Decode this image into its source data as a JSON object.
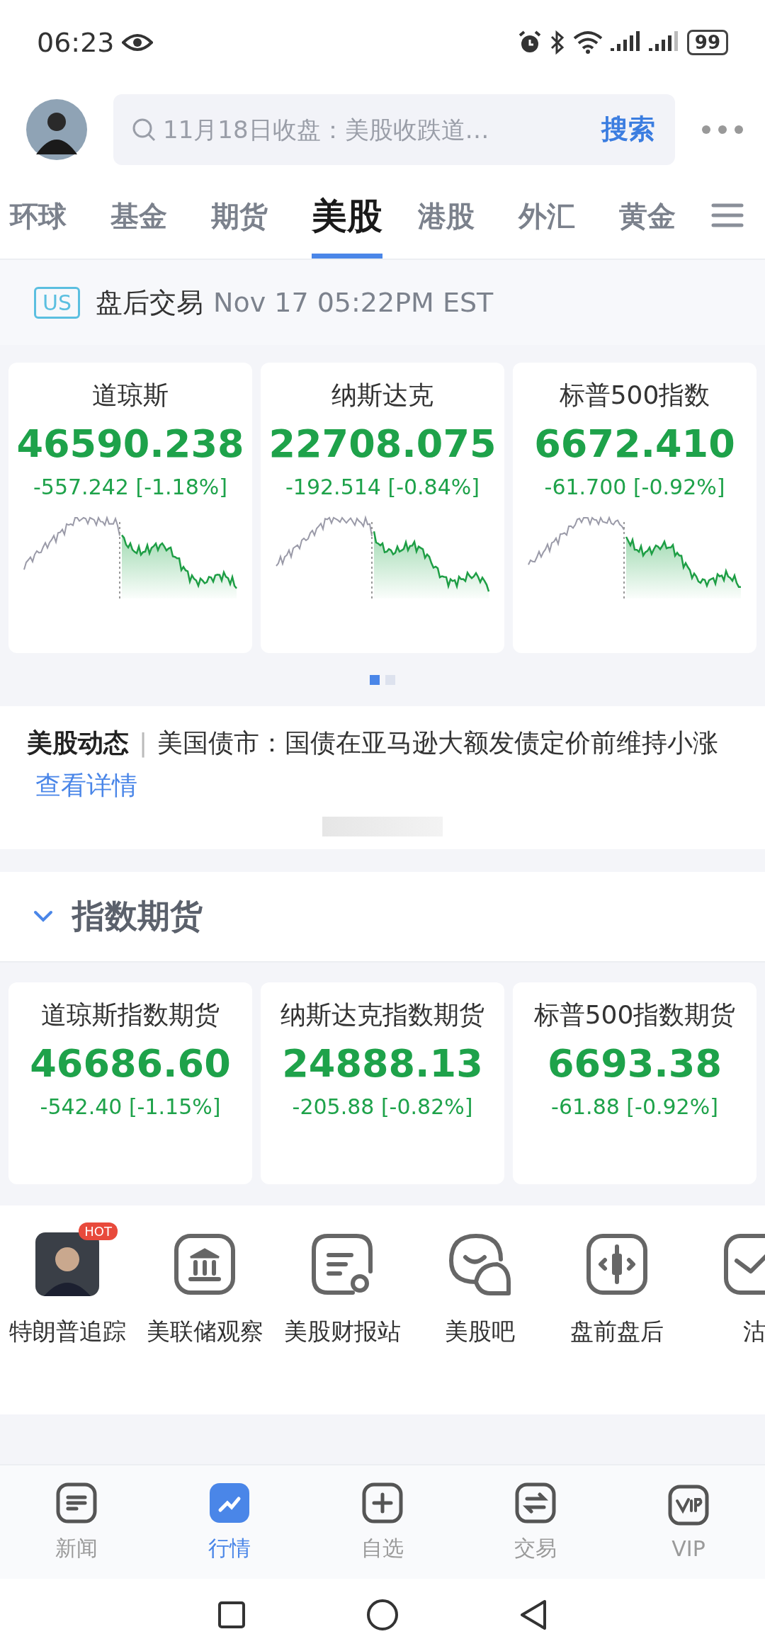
{
  "status_bar": {
    "time": "06:23",
    "battery": "99"
  },
  "search": {
    "placeholder": "11月18日收盘：美股收跌道…",
    "button": "搜索"
  },
  "tabs": [
    {
      "label": "环球",
      "selected": false
    },
    {
      "label": "基金",
      "selected": false
    },
    {
      "label": "期货",
      "selected": false
    },
    {
      "label": "美股",
      "selected": true
    },
    {
      "label": "港股",
      "selected": false
    },
    {
      "label": "外汇",
      "selected": false
    },
    {
      "label": "黄金",
      "selected": false
    }
  ],
  "session": {
    "badge": "US",
    "label": "盘后交易",
    "time": "Nov 17 05:22PM EST"
  },
  "indices": [
    {
      "name": "道琼斯",
      "value": "46590.238",
      "change": "-557.242 [-1.18%]"
    },
    {
      "name": "纳斯达克",
      "value": "22708.075",
      "change": "-192.514 [-0.84%]"
    },
    {
      "name": "标普500指数",
      "value": "6672.410",
      "change": "-61.700 [-0.92%]"
    }
  ],
  "pager": [
    {
      "selected": true
    },
    {
      "selected": false
    }
  ],
  "news": {
    "tag": "美股动态",
    "separator": "|",
    "text": "美国债市：国债在亚马逊大额发债定价前维持小涨",
    "link": "查看详情"
  },
  "futures_section": {
    "title": "指数期货",
    "expanded": true
  },
  "futures": [
    {
      "name": "道琼斯指数期货",
      "value": "46686.60",
      "change": "-542.40 [-1.15%]"
    },
    {
      "name": "纳斯达克指数期货",
      "value": "24888.13",
      "change": "-205.88 [-0.82%]"
    },
    {
      "name": "标普500指数期货",
      "value": "6693.38",
      "change": "-61.88 [-0.92%]"
    }
  ],
  "shortcuts": [
    {
      "label": "特朗普追踪",
      "kind": "portrait",
      "badge": "HOT"
    },
    {
      "label": "美联储观察",
      "kind": "bank"
    },
    {
      "label": "美股财报站",
      "kind": "report"
    },
    {
      "label": "美股吧",
      "kind": "chat"
    },
    {
      "label": "盘前盘后",
      "kind": "candle"
    },
    {
      "label": "沽",
      "kind": "short"
    }
  ],
  "bottom_nav": [
    {
      "label": "新闻",
      "kind": "news",
      "selected": false
    },
    {
      "label": "行情",
      "kind": "market",
      "selected": true
    },
    {
      "label": "自选",
      "kind": "watch",
      "selected": false
    },
    {
      "label": "交易",
      "kind": "trade",
      "selected": false
    },
    {
      "label": "VIP",
      "kind": "vip",
      "selected": false
    }
  ]
}
